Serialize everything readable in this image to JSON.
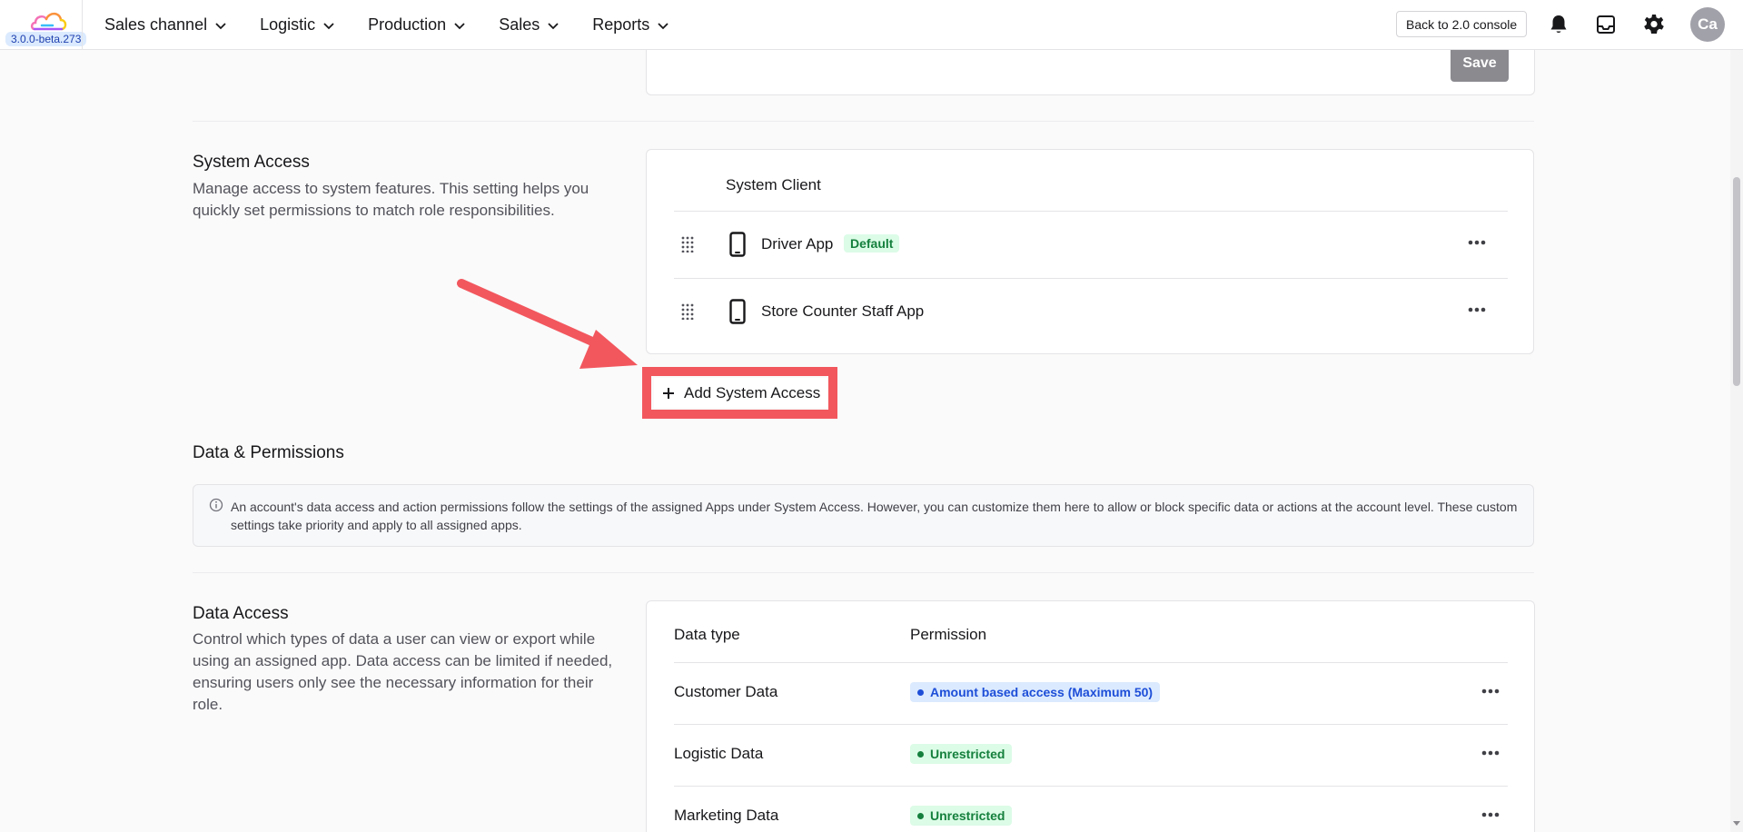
{
  "app": {
    "version": "3.0.0-beta.273"
  },
  "nav": {
    "items": [
      {
        "label": "Sales channel"
      },
      {
        "label": "Logistic"
      },
      {
        "label": "Production"
      },
      {
        "label": "Sales"
      },
      {
        "label": "Reports"
      }
    ],
    "back_label": "Back to 2.0 console",
    "avatar_initials": "Ca"
  },
  "top_card": {
    "save_label": "Save"
  },
  "system_access": {
    "title": "System Access",
    "description": "Manage access to system features. This setting helps you quickly set permissions to match role responsibilities.",
    "column_header": "System Client",
    "apps": [
      {
        "name": "Driver App",
        "badge": "Default"
      },
      {
        "name": "Store Counter Staff App",
        "badge": ""
      }
    ],
    "add_label": "Add System Access"
  },
  "data_permissions": {
    "title": "Data & Permissions",
    "info_text": "An account's data access and action permissions follow the settings of the assigned Apps under System Access. However, you can customize them here to allow or block specific data or actions at the account level. These custom settings take priority and apply to all assigned apps."
  },
  "data_access": {
    "title": "Data Access",
    "description": "Control which types of data a user can view or export while using an assigned app. Data access can be limited if needed, ensuring users only see the necessary information for their role.",
    "columns": [
      "Data type",
      "Permission"
    ],
    "rows": [
      {
        "type": "Customer Data",
        "permission": "Amount based access  (Maximum 50)",
        "status": "blue"
      },
      {
        "type": "Logistic Data",
        "permission": "Unrestricted",
        "status": "green"
      },
      {
        "type": "Marketing Data",
        "permission": "Unrestricted",
        "status": "green"
      }
    ]
  },
  "colors": {
    "highlight": "#f2575e",
    "permission_blue": "#1d4ed8",
    "permission_green": "#15803d"
  }
}
